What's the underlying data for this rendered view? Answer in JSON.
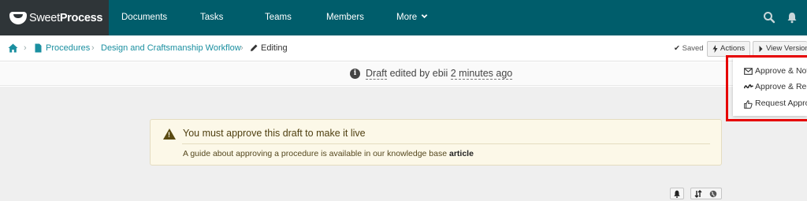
{
  "app": {
    "logo_light": "Sweet",
    "logo_bold": "Process"
  },
  "nav": {
    "items": [
      {
        "label": "Documents"
      },
      {
        "label": "Tasks"
      },
      {
        "label": "Teams"
      },
      {
        "label": "Members"
      },
      {
        "label": "More"
      }
    ],
    "icons": [
      "search-icon",
      "bell-icon"
    ]
  },
  "breadcrumb": {
    "items": [
      {
        "label": "Procedures"
      },
      {
        "label": "Design and Craftsmanship Workflow"
      }
    ],
    "current": "Editing"
  },
  "toolbar": {
    "saved": "Saved",
    "actions": "Actions",
    "view_version": "View Version"
  },
  "draft": {
    "status": "Draft",
    "edited_by": "edited by ebii",
    "time": "2 minutes ago"
  },
  "alert": {
    "title": "You must approve this draft to make it live",
    "body": "A guide about approving a procedure is available in our knowledge base",
    "link": "article"
  },
  "dropdown": {
    "items": [
      {
        "label": "Approve & Notify",
        "icon": "envelope-icon"
      },
      {
        "label": "Approve & Re-sign",
        "icon": "signature-icon"
      },
      {
        "label": "Request Approval",
        "icon": "thumbs-up-icon"
      }
    ]
  },
  "colors": {
    "nav_bg": "#005d6b",
    "logo_bg": "#2f3538",
    "link": "#1a8fa0",
    "alert_bg": "#fcf8e8",
    "highlight": "#e60000"
  }
}
